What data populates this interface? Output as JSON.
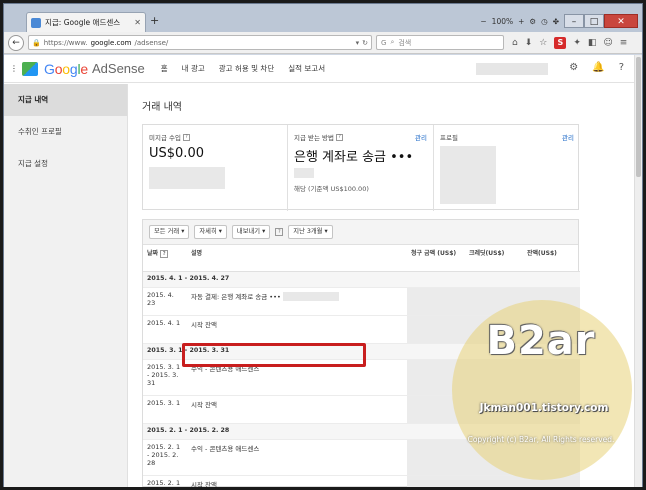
{
  "browser": {
    "tab_title": "지급: Google 애드센스",
    "new_tab": "+",
    "zoom": "100%",
    "url_prefix": "https://www.",
    "url_domain": "google.com",
    "url_path": "/adsense/",
    "search_placeholder": "검색"
  },
  "header": {
    "logo_google": [
      "G",
      "o",
      "o",
      "g",
      "l",
      "e"
    ],
    "logo_adsense": "AdSense",
    "nav": [
      "홈",
      "내 광고",
      "광고 허용 및 차단",
      "실적 보고서"
    ]
  },
  "sidebar": {
    "items": [
      {
        "label": "지급 내역",
        "active": true
      },
      {
        "label": "수취인 프로필",
        "active": false
      },
      {
        "label": "지급 설정",
        "active": false
      }
    ]
  },
  "main": {
    "title": "거래 내역",
    "cards": {
      "unpaid_label": "미지급 수입",
      "unpaid_value": "US$0.00",
      "method_label": "지급 받는 방법",
      "method_manage": "관리",
      "method_value": "은행 계좌로 송금 •••",
      "threshold": "해당 (기준액 US$100.00)",
      "profile_label": "프로필",
      "profile_manage": "관리"
    },
    "filters": [
      "모든 거래",
      "자세히",
      "내보내기",
      "지난 3개월"
    ],
    "table": {
      "headers": [
        "날짜",
        "설명",
        "청구 금액 (US$)",
        "크레딧(US$)",
        "잔액(US$)"
      ],
      "sections": [
        {
          "period": "2015. 4. 1 - 2015. 4. 27",
          "rows": [
            {
              "date": "2015. 4. 23",
              "desc": "자동 결제: 은행 계좌로 송금 •••"
            },
            {
              "date": "2015. 4. 1",
              "desc": "시작 잔액"
            }
          ]
        },
        {
          "period": "2015. 3. 1 - 2015. 3. 31",
          "rows": [
            {
              "date": "2015. 3. 1 - 2015. 3. 31",
              "desc": "수익 - 콘텐츠용 애드센스"
            },
            {
              "date": "2015. 3. 1",
              "desc": "시작 잔액"
            }
          ]
        },
        {
          "period": "2015. 2. 1 - 2015. 2. 28",
          "rows": [
            {
              "date": "2015. 2. 1 - 2015. 2. 28",
              "desc": "수익 - 콘텐츠용 애드센스"
            },
            {
              "date": "2015. 2. 1",
              "desc": "시작 잔액"
            }
          ]
        }
      ]
    }
  },
  "watermark": {
    "title": "B2ar",
    "url": "Jkman001.tistory.com",
    "copyright": "Copyright (c) B2ar, All Rights reserved."
  },
  "colors": {
    "highlight": "#c81e1e",
    "link": "#1a67c7",
    "watermark": "#e8d278"
  }
}
